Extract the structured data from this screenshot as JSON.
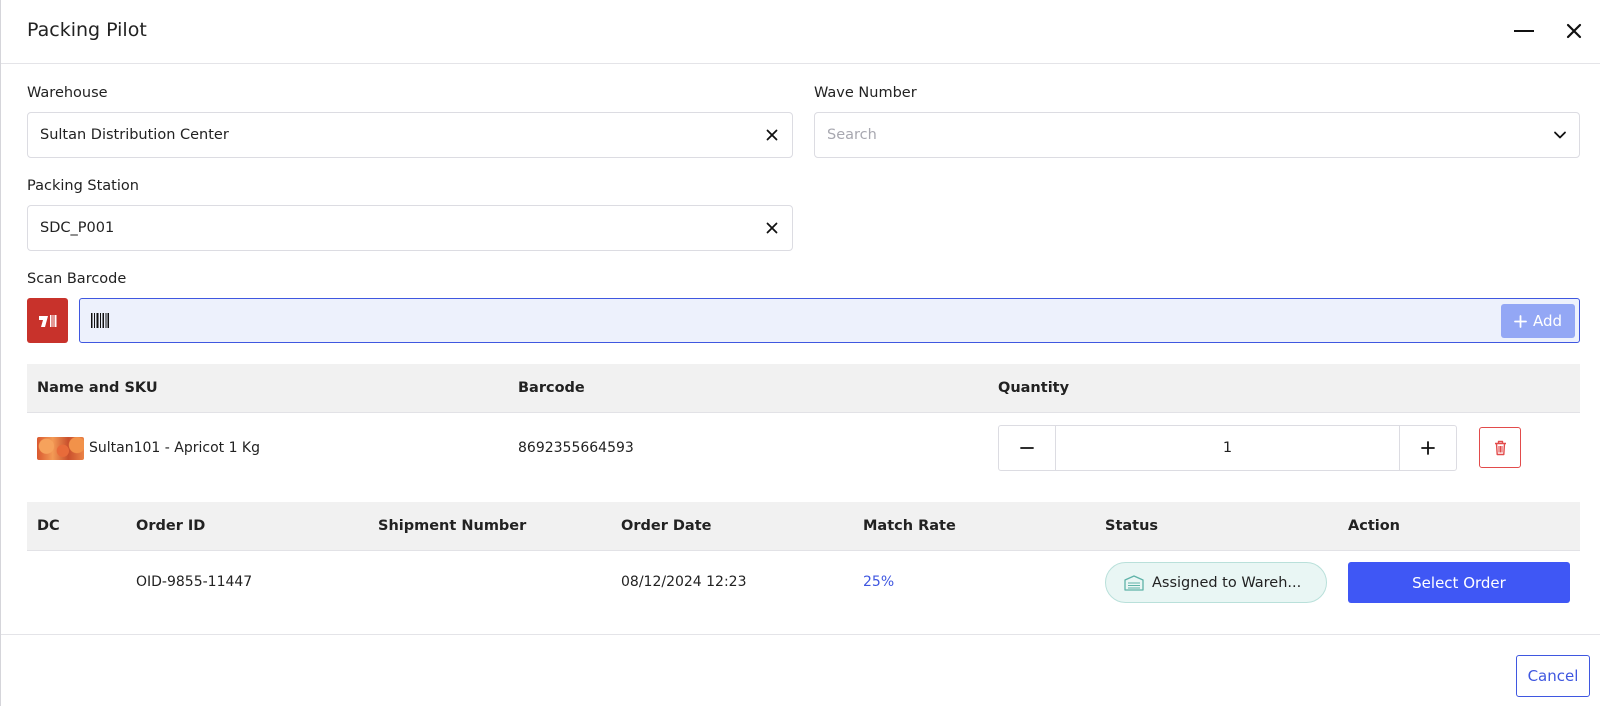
{
  "modal": {
    "title": "Packing Pilot"
  },
  "form": {
    "warehouse": {
      "label": "Warehouse",
      "value": "Sultan Distribution Center"
    },
    "wave_number": {
      "label": "Wave Number",
      "placeholder": "Search"
    },
    "packing_station": {
      "label": "Packing Station",
      "value": "SDC_P001"
    },
    "scan_barcode": {
      "label": "Scan Barcode",
      "value": "",
      "add_label": "Add"
    }
  },
  "items_table": {
    "headers": {
      "name": "Name and SKU",
      "barcode": "Barcode",
      "quantity": "Quantity"
    },
    "rows": [
      {
        "name": "Sultan101 - Apricot 1 Kg",
        "barcode": "8692355664593",
        "quantity": "1"
      }
    ]
  },
  "orders_table": {
    "headers": {
      "dc": "DC",
      "order_id": "Order ID",
      "shipment_number": "Shipment Number",
      "order_date": "Order Date",
      "match_rate": "Match Rate",
      "status": "Status",
      "action": "Action"
    },
    "rows": [
      {
        "dc": "",
        "order_id": "OID-9855-11447",
        "shipment_number": "",
        "order_date": "08/12/2024 12:23",
        "match_rate": "25%",
        "status": "Assigned to Wareh...",
        "action_label": "Select Order"
      }
    ]
  },
  "footer": {
    "cancel_label": "Cancel"
  },
  "colors": {
    "primary": "#3f57f5",
    "danger": "#c8322b",
    "status_bg": "#e9f6f4",
    "link": "#3f57e0"
  },
  "icons": [
    "minimize-icon",
    "close-icon",
    "clear-icon",
    "chevron-down-icon",
    "barcode-scanner-icon",
    "barcode-icon",
    "plus-icon",
    "minus-icon",
    "trash-icon",
    "warehouse-icon"
  ]
}
